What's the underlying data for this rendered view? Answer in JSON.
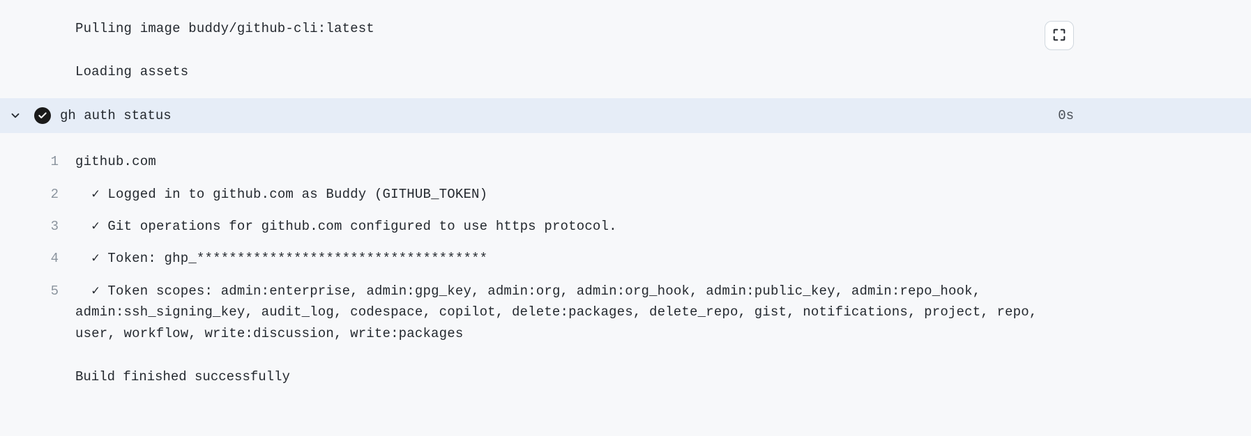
{
  "preLines": {
    "pull": "Pulling image buddy/github-cli:latest",
    "load": "Loading assets"
  },
  "command": {
    "text": "gh auth status",
    "duration": "0s"
  },
  "output": [
    {
      "n": "1",
      "text": "github.com"
    },
    {
      "n": "2",
      "text": "  ✓ Logged in to github.com as Buddy (GITHUB_TOKEN)"
    },
    {
      "n": "3",
      "text": "  ✓ Git operations for github.com configured to use https protocol."
    },
    {
      "n": "4",
      "text": "  ✓ Token: ghp_************************************"
    },
    {
      "n": "5",
      "text": "  ✓ Token scopes: admin:enterprise, admin:gpg_key, admin:org, admin:org_hook, admin:public_key, admin:repo_hook, admin:ssh_signing_key, audit_log, codespace, copilot, delete:packages, delete_repo, gist, notifications, project, repo, user, workflow, write:discussion, write:packages"
    }
  ],
  "footer": "Build finished successfully"
}
